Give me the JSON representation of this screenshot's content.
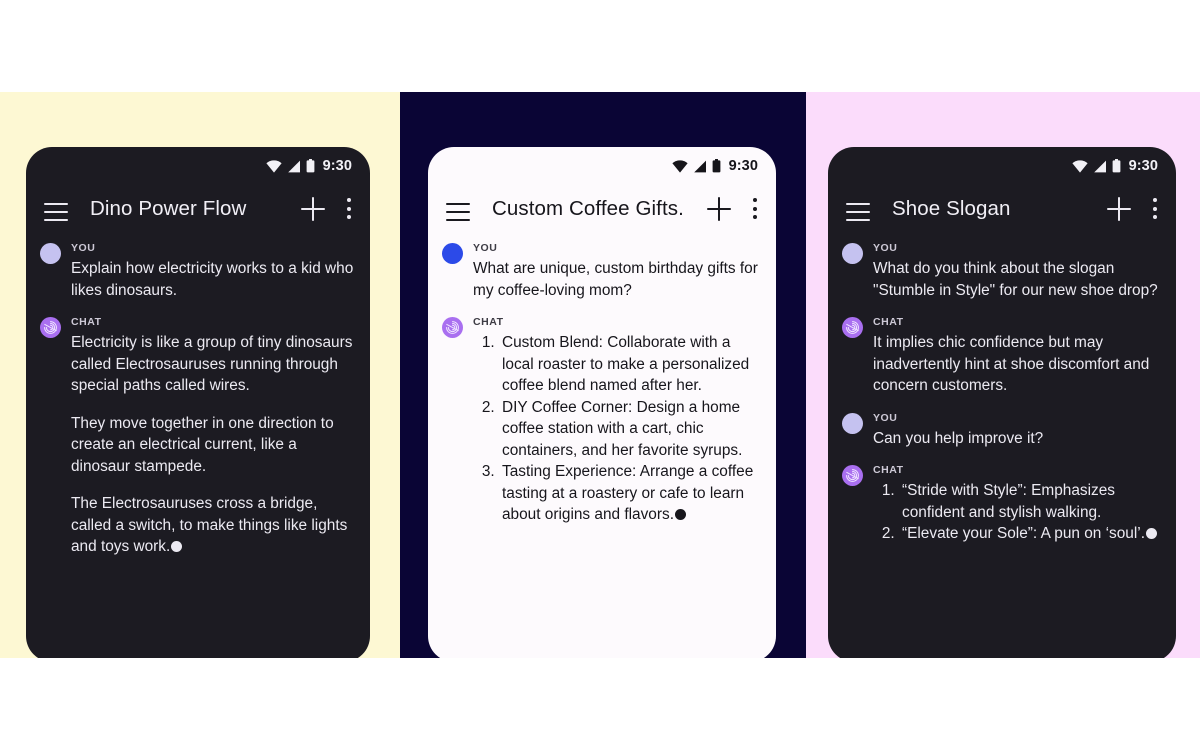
{
  "panels": [
    {
      "background_color": "#fdf8d3",
      "theme": "dark",
      "phone": {
        "status": {
          "time": "9:30",
          "icons": [
            "wifi-icon",
            "signal-icon",
            "battery-icon"
          ]
        },
        "appbar": {
          "menu": "menu-icon",
          "title": "Dino Power Flow",
          "add": "plus-icon",
          "overflow": "more-vert-icon"
        },
        "messages": [
          {
            "role": "YOU",
            "avatar_color": "#c5c2f0",
            "avatar_type": "plain",
            "blocks": [
              {
                "kind": "para",
                "text": "Explain how electricity works to a kid who likes dinosaurs."
              }
            ]
          },
          {
            "role": "CHAT",
            "avatar_color": "#a96ff0",
            "avatar_type": "swirl",
            "blocks": [
              {
                "kind": "para",
                "text": "Electricity is like a group of tiny dinosaurs called Electrosauruses running through special paths called wires."
              },
              {
                "kind": "para",
                "text": "They move together in one direction to create an electrical current, like a dinosaur stampede."
              },
              {
                "kind": "para",
                "text": "The Electrosauruses cross a bridge, called a switch, to make things like lights and toys work.",
                "trailing_dot": true
              }
            ]
          }
        ]
      }
    },
    {
      "background_color": "#0a0535",
      "theme": "light",
      "phone": {
        "status": {
          "time": "9:30",
          "icons": [
            "wifi-icon",
            "signal-icon",
            "battery-icon"
          ]
        },
        "appbar": {
          "menu": "menu-icon",
          "title": "Custom Coffee Gifts.",
          "add": "plus-icon",
          "overflow": "more-vert-icon"
        },
        "messages": [
          {
            "role": "YOU",
            "avatar_color": "#2c4ae8",
            "avatar_type": "plain",
            "blocks": [
              {
                "kind": "para",
                "text": "What are unique, custom birthday gifts for my coffee-loving mom?"
              }
            ]
          },
          {
            "role": "CHAT",
            "avatar_color": "#a96ff0",
            "avatar_type": "swirl",
            "blocks": [
              {
                "kind": "list",
                "items": [
                  {
                    "text": "Custom Blend: Collaborate with a local roaster to make a personalized coffee blend named after her."
                  },
                  {
                    "text": "DIY Coffee Corner: Design a home coffee station with a cart, chic containers, and her favorite syrups."
                  },
                  {
                    "text": "Tasting Experience: Arrange a coffee tasting at a roastery or cafe to learn about origins and flavors.",
                    "trailing_dot": true
                  }
                ]
              }
            ]
          }
        ]
      }
    },
    {
      "background_color": "#fbdcfb",
      "theme": "dark",
      "phone": {
        "status": {
          "time": "9:30",
          "icons": [
            "wifi-icon",
            "signal-icon",
            "battery-icon"
          ]
        },
        "appbar": {
          "menu": "menu-icon",
          "title": "Shoe Slogan",
          "add": "plus-icon",
          "overflow": "more-vert-icon"
        },
        "messages": [
          {
            "role": "YOU",
            "avatar_color": "#c5c2f0",
            "avatar_type": "plain",
            "blocks": [
              {
                "kind": "para",
                "text": "What do you think about the slogan \"Stumble in Style\" for our new shoe drop?"
              }
            ]
          },
          {
            "role": "CHAT",
            "avatar_color": "#a96ff0",
            "avatar_type": "swirl",
            "blocks": [
              {
                "kind": "para",
                "text": "It implies chic confidence but may inadvertently hint at shoe discomfort and concern customers."
              }
            ]
          },
          {
            "role": "YOU",
            "avatar_color": "#c5c2f0",
            "avatar_type": "plain",
            "blocks": [
              {
                "kind": "para",
                "text": "Can you help improve it?"
              }
            ]
          },
          {
            "role": "CHAT",
            "avatar_color": "#a96ff0",
            "avatar_type": "swirl",
            "blocks": [
              {
                "kind": "list",
                "items": [
                  {
                    "text": "“Stride with Style”: Emphasizes confident and stylish walking."
                  },
                  {
                    "text": "“Elevate your Sole”: A pun on ‘soul’.",
                    "trailing_dot": true
                  }
                ]
              }
            ]
          }
        ]
      }
    }
  ]
}
